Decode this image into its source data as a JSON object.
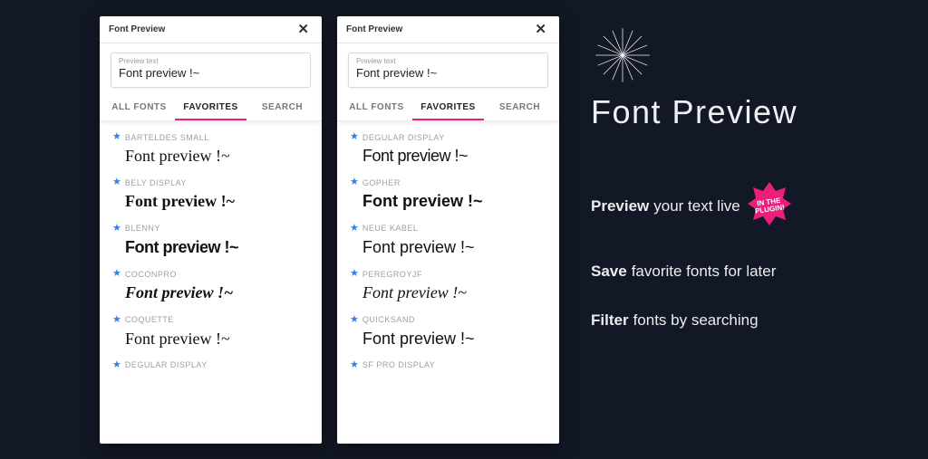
{
  "panel_title": "Font Preview",
  "preview": {
    "legend": "Preview text",
    "value": "Font preview !~"
  },
  "tabs": {
    "all": "ALL FONTS",
    "favorites": "FAVORITES",
    "search": "SEARCH"
  },
  "sample_text": "Font preview !~",
  "left_fonts": [
    {
      "name": "BARTELDES SMALL",
      "style": "serif-fancy"
    },
    {
      "name": "BELY DISPLAY",
      "style": "display-black"
    },
    {
      "name": "BLENNY",
      "style": "slab-black"
    },
    {
      "name": "COCONPRO",
      "style": "italic-round"
    },
    {
      "name": "COQUETTE",
      "style": "script-thin"
    },
    {
      "name": "DEGULAR DISPLAY",
      "style": "geo-sans"
    }
  ],
  "right_fonts": [
    {
      "name": "DEGULAR DISPLAY",
      "style": "geo-sans"
    },
    {
      "name": "GOPHER",
      "style": "grotesk"
    },
    {
      "name": "NEUE KABEL",
      "style": "humanist"
    },
    {
      "name": "PEREGROYJF",
      "style": "script-cursive"
    },
    {
      "name": "QUICKSAND",
      "style": "round-sans"
    },
    {
      "name": "SF PRO DISPLAY",
      "style": "round-sans"
    }
  ],
  "marketing": {
    "title": "Font Preview",
    "burst": "IN THE\nPLUGIN!",
    "b1_bold": "Preview",
    "b1_rest": "your text live",
    "b2_bold": "Save",
    "b2_rest": "favorite fonts for later",
    "b3_bold": "Filter",
    "b3_rest": "fonts by searching"
  },
  "colors": {
    "accent": "#ec1e79",
    "star": "#2f80ed",
    "bg": "#131826"
  }
}
